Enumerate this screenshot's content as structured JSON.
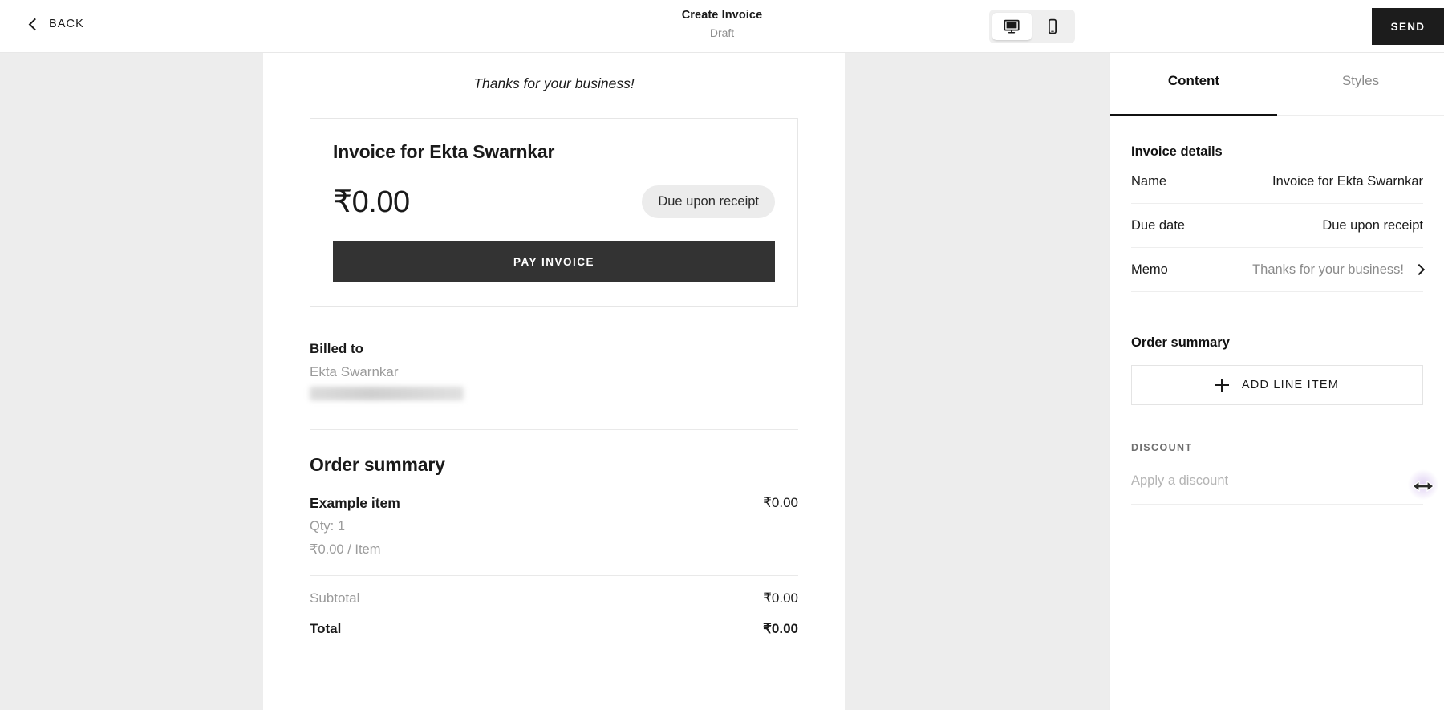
{
  "topbar": {
    "back_label": "BACK",
    "back_icon": "chevron-left-icon",
    "title": "Create Invoice",
    "subtitle": "Draft",
    "device_toggle": {
      "desktop_icon": "desktop-monitor-icon",
      "mobile_icon": "mobile-phone-icon",
      "selected": "desktop"
    },
    "send_label": "SEND"
  },
  "preview": {
    "memo": "Thanks for your business!",
    "card": {
      "title": "Invoice for Ekta Swarnkar",
      "amount": "₹0.00",
      "due_badge": "Due upon receipt",
      "pay_label": "PAY INVOICE"
    },
    "billed_to": {
      "heading": "Billed to",
      "name": "Ekta Swarnkar",
      "redacted_line": ""
    },
    "order_summary": {
      "heading": "Order summary",
      "items": [
        {
          "name": "Example item",
          "qty": "Qty: 1",
          "unit_price": "₹0.00 / Item",
          "amount": "₹0.00"
        }
      ],
      "subtotal_label": "Subtotal",
      "subtotal_value": "₹0.00",
      "total_label": "Total",
      "total_value": "₹0.00"
    }
  },
  "right_panel": {
    "tabs": [
      {
        "label": "Content",
        "active": true
      },
      {
        "label": "Styles",
        "active": false
      }
    ],
    "invoice_details": {
      "heading": "Invoice details",
      "rows": [
        {
          "label": "Name",
          "value": "Invoice for Ekta Swarnkar",
          "muted": false,
          "chevron": false
        },
        {
          "label": "Due date",
          "value": "Due upon receipt",
          "muted": false,
          "chevron": false
        },
        {
          "label": "Memo",
          "value": "Thanks for your business!",
          "muted": true,
          "chevron": true
        }
      ]
    },
    "order_summary": {
      "heading": "Order summary",
      "add_line_item_label": "ADD LINE ITEM",
      "add_icon": "plus-icon"
    },
    "discount": {
      "section_label": "DISCOUNT",
      "label": "Apply a discount",
      "toggle_state": "off"
    }
  },
  "colors": {
    "accent": "#1c1c1c",
    "page_bg": "#ededed",
    "panel_bg": "#ffffff",
    "muted_text": "#9b9b9b",
    "badge_bg": "#ececec",
    "pay_button_bg": "#333333"
  }
}
